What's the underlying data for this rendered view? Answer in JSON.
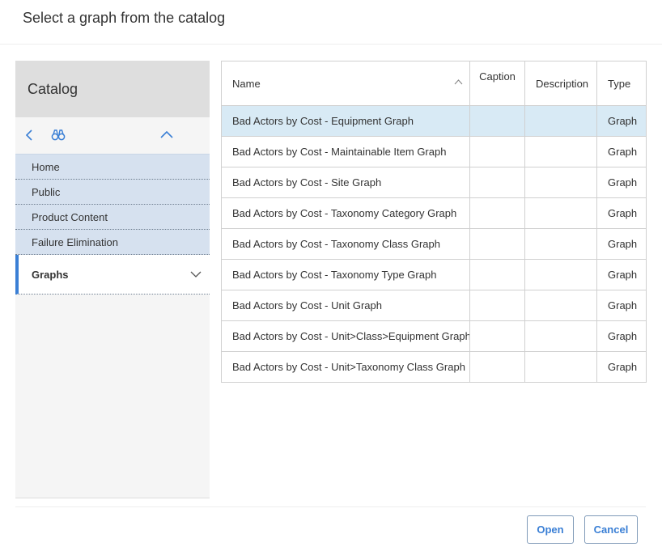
{
  "dialog": {
    "title": "Select a graph from the catalog"
  },
  "catalog": {
    "header": "Catalog",
    "toolbar_icons": [
      "chevron-left-icon",
      "binoculars-icon",
      "chevron-up-icon"
    ],
    "breadcrumbs": [
      "Home",
      "Public",
      "Product Content",
      "Failure Elimination"
    ],
    "current": "Graphs"
  },
  "table": {
    "columns": [
      "Name",
      "Caption",
      "Description",
      "Type"
    ],
    "sorted_by": "Name",
    "selected_row": 0,
    "rows": [
      {
        "name": "Bad Actors by Cost - Equipment Graph",
        "caption": "",
        "description": "",
        "type": "Graph"
      },
      {
        "name": "Bad Actors by Cost - Maintainable Item Graph",
        "caption": "",
        "description": "",
        "type": "Graph"
      },
      {
        "name": "Bad Actors by Cost - Site Graph",
        "caption": "",
        "description": "",
        "type": "Graph"
      },
      {
        "name": "Bad Actors by Cost - Taxonomy Category Graph",
        "caption": "",
        "description": "",
        "type": "Graph"
      },
      {
        "name": "Bad Actors by Cost - Taxonomy Class Graph",
        "caption": "",
        "description": "",
        "type": "Graph"
      },
      {
        "name": "Bad Actors by Cost - Taxonomy Type Graph",
        "caption": "",
        "description": "",
        "type": "Graph"
      },
      {
        "name": "Bad Actors by Cost - Unit Graph",
        "caption": "",
        "description": "",
        "type": "Graph"
      },
      {
        "name": "Bad Actors by Cost - Unit>Class>Equipment Graph",
        "caption": "",
        "description": "",
        "type": "Graph"
      },
      {
        "name": "Bad Actors by Cost - Unit>Taxonomy Class Graph",
        "caption": "",
        "description": "",
        "type": "Graph"
      }
    ]
  },
  "footer": {
    "open_label": "Open",
    "cancel_label": "Cancel"
  },
  "colors": {
    "accent": "#3a7fd5",
    "selected_row": "#d8eaf5",
    "breadcrumb_bg": "#d6e1ef"
  }
}
